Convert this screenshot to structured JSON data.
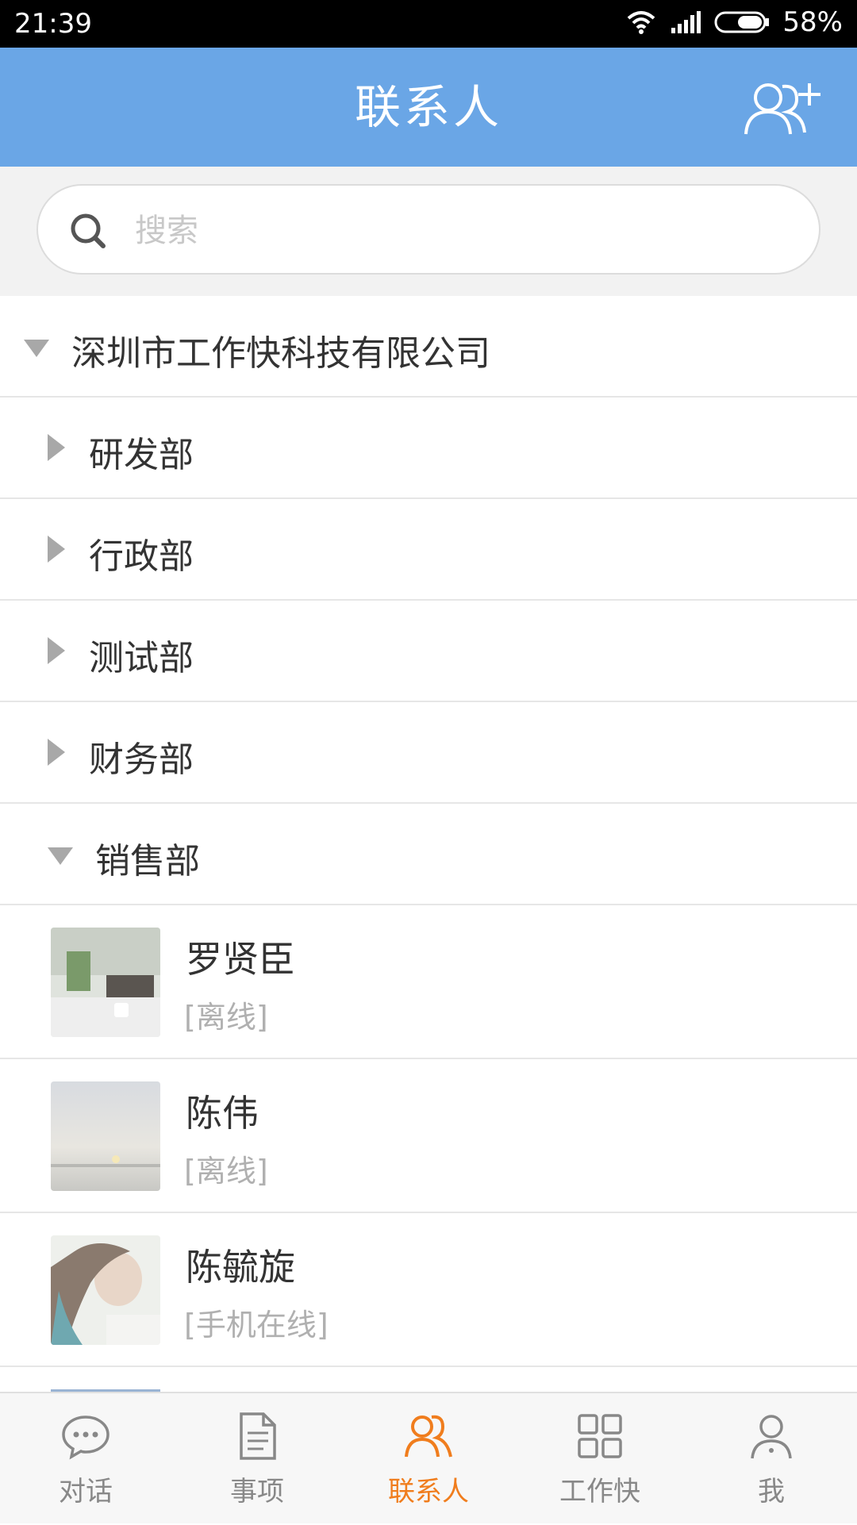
{
  "status_bar": {
    "time": "21:39",
    "battery": "58%"
  },
  "header": {
    "title": "联系人"
  },
  "search": {
    "placeholder": "搜索"
  },
  "organization": {
    "name": "深圳市工作快科技有限公司",
    "departments": [
      {
        "label": "研发部"
      },
      {
        "label": "行政部"
      },
      {
        "label": "测试部"
      },
      {
        "label": "财务部"
      },
      {
        "label": "销售部"
      }
    ]
  },
  "contacts": [
    {
      "name": "罗贤臣",
      "status": "[离线]"
    },
    {
      "name": "陈伟",
      "status": "[离线]"
    },
    {
      "name": "陈毓旋",
      "status": "[手机在线]"
    }
  ],
  "tabs": [
    {
      "label": "对话",
      "icon": "chat-bubble-icon"
    },
    {
      "label": "事项",
      "icon": "document-icon"
    },
    {
      "label": "联系人",
      "icon": "contacts-icon"
    },
    {
      "label": "工作快",
      "icon": "apps-grid-icon"
    },
    {
      "label": "我",
      "icon": "profile-icon"
    }
  ],
  "colors": {
    "header": "#6aa6e6",
    "active_tab": "#f07d1d"
  }
}
